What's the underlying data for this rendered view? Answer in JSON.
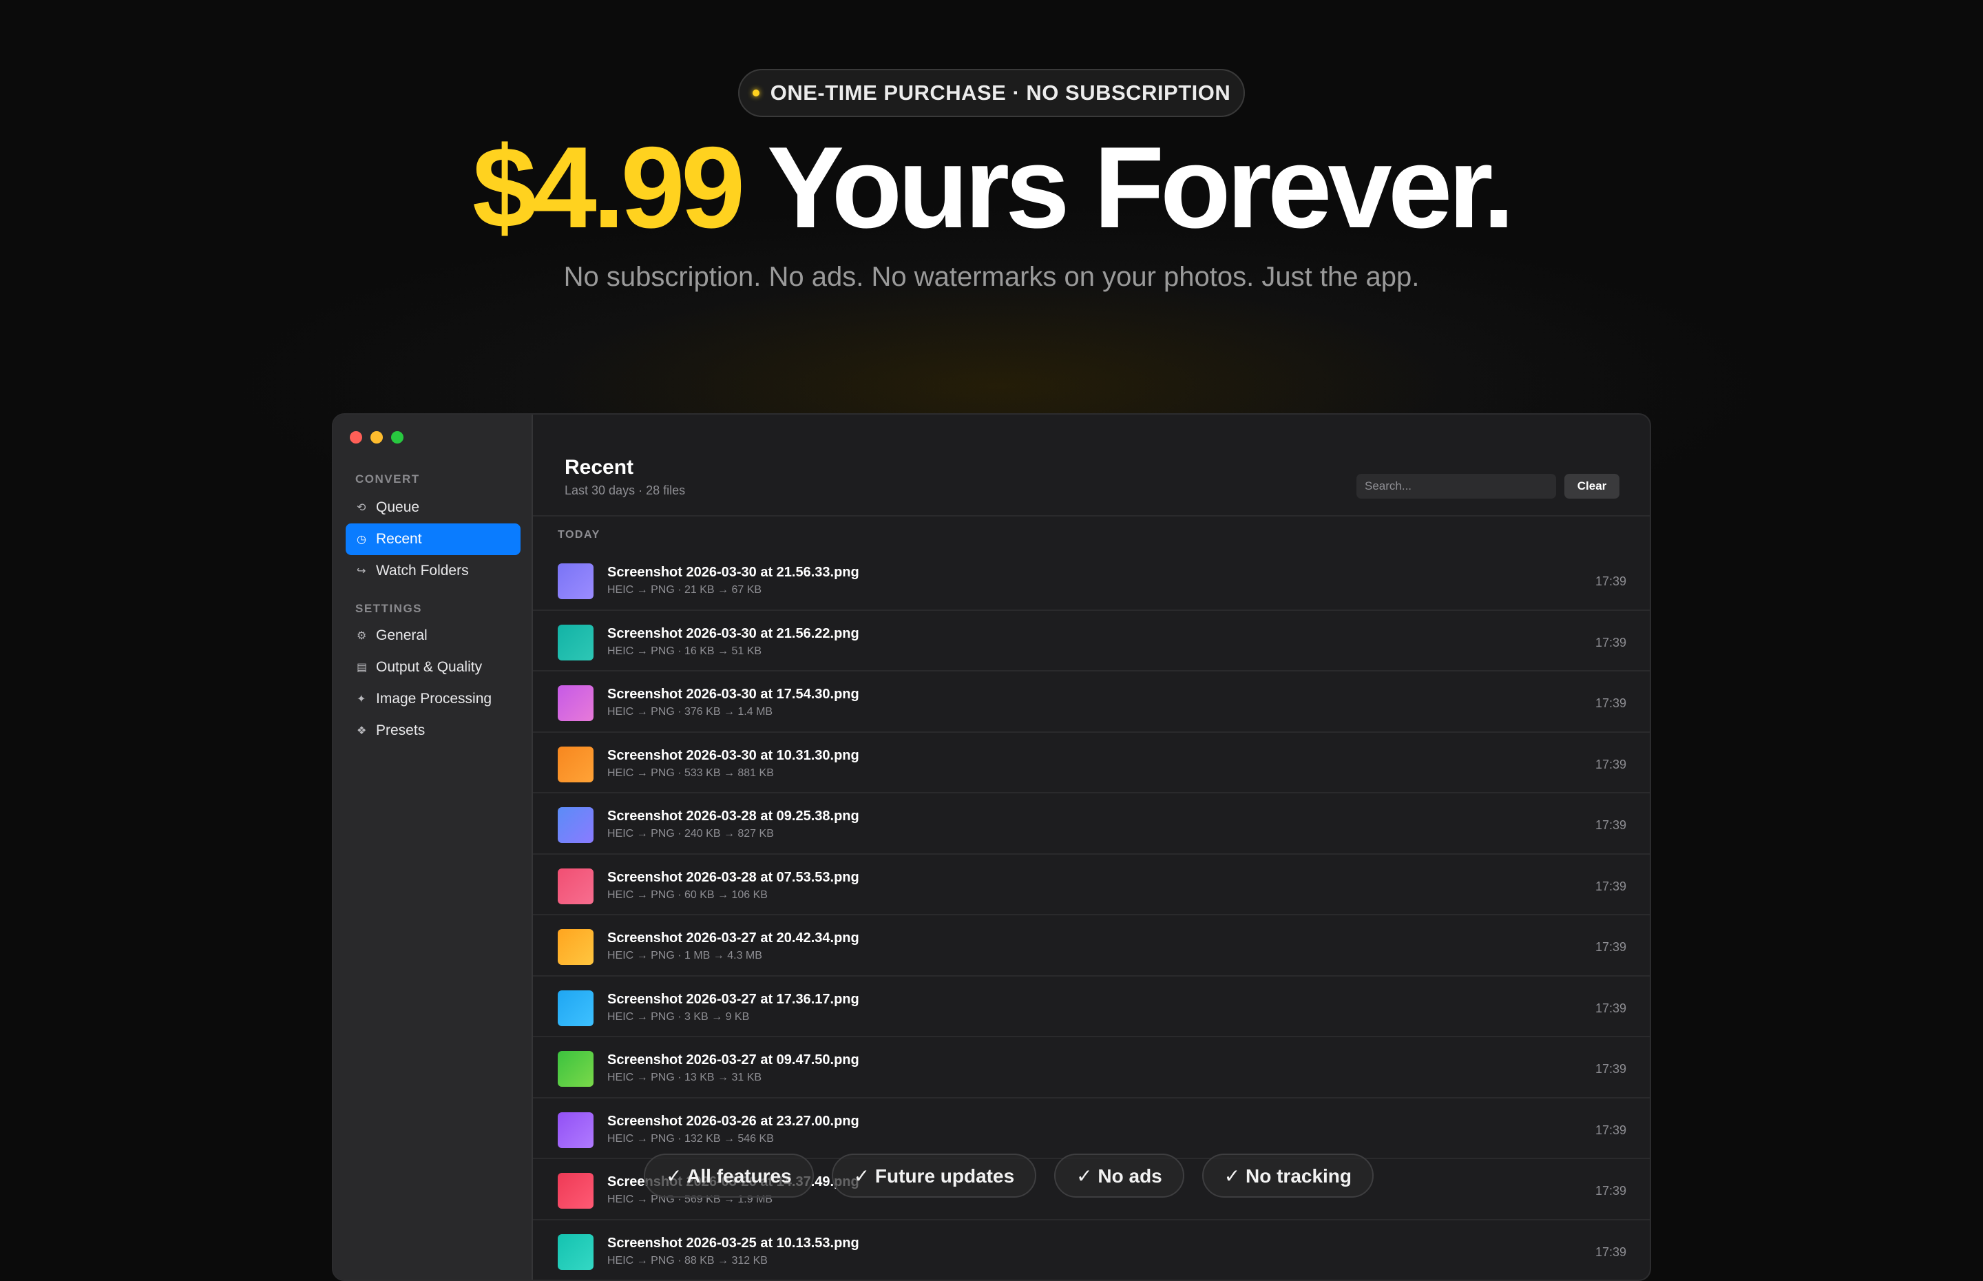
{
  "hero": {
    "badge": "ONE-TIME PURCHASE · NO SUBSCRIPTION",
    "price": "$4.99",
    "headline_rest": " Yours Forever.",
    "subheadline": "No subscription. No ads. No watermarks on your photos. Just the app."
  },
  "sidebar": {
    "convert_label": "CONVERT",
    "settings_label": "SETTINGS",
    "convert_items": [
      {
        "label": "Queue",
        "icon": "⟲"
      },
      {
        "label": "Recent",
        "icon": "◷"
      },
      {
        "label": "Watch Folders",
        "icon": "↪"
      }
    ],
    "settings_items": [
      {
        "label": "General",
        "icon": "⚙"
      },
      {
        "label": "Output & Quality",
        "icon": "▤"
      },
      {
        "label": "Image Processing",
        "icon": "✦"
      },
      {
        "label": "Presets",
        "icon": "❖"
      }
    ]
  },
  "main": {
    "title": "Recent",
    "subtitle": "Last 30 days · 28 files",
    "search_placeholder": "Search...",
    "clear_label": "Clear",
    "group_label": "TODAY",
    "files": [
      {
        "name": "Screenshot 2026-03-30 at 21.56.33.png",
        "meta": "HEIC → PNG · 21 KB → 67 KB",
        "time": "17:39",
        "color_a": "#7a74f5",
        "color_b": "#9b8cff"
      },
      {
        "name": "Screenshot 2026-03-30 at 21.56.22.png",
        "meta": "HEIC → PNG · 16 KB → 51 KB",
        "time": "17:39",
        "color_a": "#12b3a6",
        "color_b": "#2ec7b5"
      },
      {
        "name": "Screenshot 2026-03-30 at 17.54.30.png",
        "meta": "HEIC → PNG · 376 KB → 1.4 MB",
        "time": "17:39",
        "color_a": "#c65ae6",
        "color_b": "#e77ad9"
      },
      {
        "name": "Screenshot 2026-03-30 at 10.31.30.png",
        "meta": "HEIC → PNG · 533 KB → 881 KB",
        "time": "17:39",
        "color_a": "#f7871f",
        "color_b": "#ffa337"
      },
      {
        "name": "Screenshot 2026-03-28 at 09.25.38.png",
        "meta": "HEIC → PNG · 240 KB → 827 KB",
        "time": "17:39",
        "color_a": "#5b8cf7",
        "color_b": "#8a7bff"
      },
      {
        "name": "Screenshot 2026-03-28 at 07.53.53.png",
        "meta": "HEIC → PNG · 60 KB → 106 KB",
        "time": "17:39",
        "color_a": "#f14f73",
        "color_b": "#f76e8f"
      },
      {
        "name": "Screenshot 2026-03-27 at 20.42.34.png",
        "meta": "HEIC → PNG · 1 MB → 4.3 MB",
        "time": "17:39",
        "color_a": "#ffa51f",
        "color_b": "#ffc640"
      },
      {
        "name": "Screenshot 2026-03-27 at 17.36.17.png",
        "meta": "HEIC → PNG · 3 KB → 9 KB",
        "time": "17:39",
        "color_a": "#1fa6f2",
        "color_b": "#3ec1ff"
      },
      {
        "name": "Screenshot 2026-03-27 at 09.47.50.png",
        "meta": "HEIC → PNG · 13 KB → 31 KB",
        "time": "17:39",
        "color_a": "#3cc23f",
        "color_b": "#7ad94a"
      },
      {
        "name": "Screenshot 2026-03-26 at 23.27.00.png",
        "meta": "HEIC → PNG · 132 KB → 546 KB",
        "time": "17:39",
        "color_a": "#9251f5",
        "color_b": "#b07aff"
      },
      {
        "name": "Screenshot 2026-03-26 at 14.37.49.png",
        "meta": "HEIC → PNG · 569 KB → 1.9 MB",
        "time": "17:39",
        "color_a": "#ee3a56",
        "color_b": "#ff5a74"
      },
      {
        "name": "Screenshot 2026-03-25 at 10.13.53.png",
        "meta": "HEIC → PNG · 88 KB → 312 KB",
        "time": "17:39",
        "color_a": "#14c2b0",
        "color_b": "#34d8c4"
      }
    ]
  },
  "chips": [
    "✓ All features",
    "✓ Future updates",
    "✓ No ads",
    "✓ No tracking"
  ]
}
